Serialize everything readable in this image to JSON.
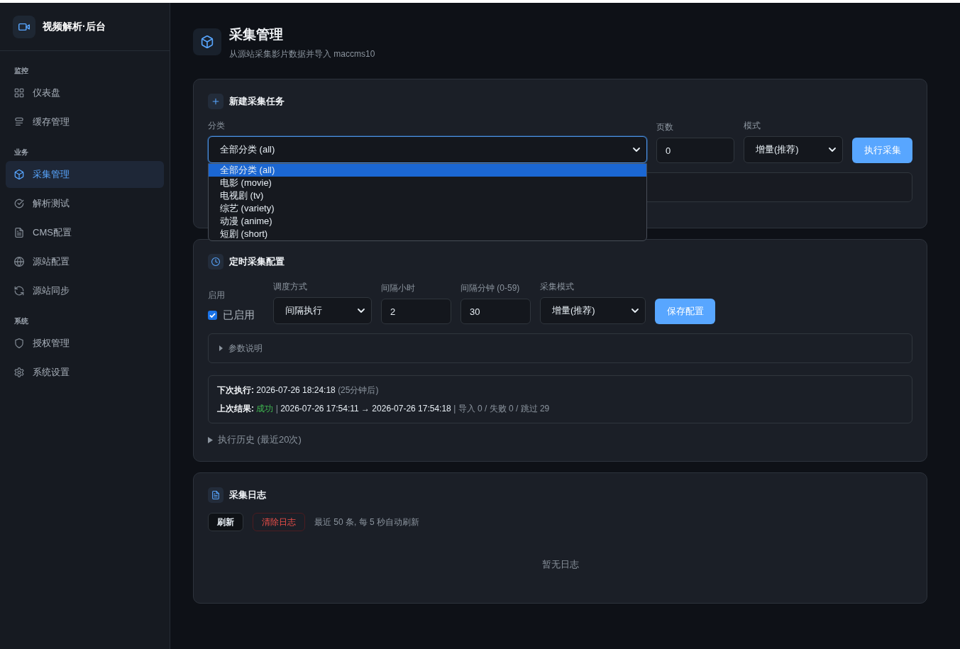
{
  "sidebar": {
    "brand": "视频解析·后台",
    "sections": [
      {
        "title": "监控",
        "items": [
          {
            "label": "仪表盘",
            "selected": false
          },
          {
            "label": "缓存管理",
            "selected": false
          }
        ]
      },
      {
        "title": "业务",
        "items": [
          {
            "label": "采集管理",
            "selected": true
          },
          {
            "label": "解析测试",
            "selected": false
          },
          {
            "label": "CMS配置",
            "selected": false
          },
          {
            "label": "源站配置",
            "selected": false
          },
          {
            "label": "源站同步",
            "selected": false
          }
        ]
      },
      {
        "title": "系统",
        "items": [
          {
            "label": "授权管理",
            "selected": false
          },
          {
            "label": "系统设置",
            "selected": false
          }
        ]
      }
    ]
  },
  "page": {
    "title": "采集管理",
    "subtitle": "从源站采集影片数据并导入 maccms10"
  },
  "new_task": {
    "title": "新建采集任务",
    "fields": [
      {
        "kind": "select",
        "label": "分类",
        "value": "全部分类 (all)",
        "expanded": true,
        "options": [
          {
            "label": "全部分类 (all)",
            "selected": true
          },
          {
            "label": "电影 (movie)",
            "selected": false
          },
          {
            "label": "电视剧 (tv)",
            "selected": false
          },
          {
            "label": "综艺 (variety)",
            "selected": false
          },
          {
            "label": "动漫 (anime)",
            "selected": false
          },
          {
            "label": "短剧 (short)",
            "selected": false
          }
        ]
      },
      {
        "kind": "input",
        "label": "页数",
        "value": "0"
      },
      {
        "kind": "select",
        "label": "模式",
        "value": "增量(推荐)",
        "expanded": false
      }
    ],
    "button": "执行采集"
  },
  "schedule": {
    "title": "定时采集配置",
    "enabled": {
      "label": "启用",
      "text": "已启用",
      "checked": true
    },
    "fields": [
      {
        "kind": "select",
        "label": "调度方式",
        "value": "间隔执行",
        "expanded": false
      },
      {
        "kind": "input",
        "label": "间隔小时",
        "value": "2"
      },
      {
        "kind": "input",
        "label": "间隔分钟 (0-59)",
        "value": "30"
      },
      {
        "kind": "select",
        "label": "采集模式",
        "value": "增量(推荐)",
        "expanded": false
      }
    ],
    "button": "保存配置",
    "params": {
      "label": "参数说明",
      "expanded": false
    },
    "status": {
      "next_run": {
        "label": "下次执行:",
        "time": "2026-07-26 18:24:18",
        "relative": "(25分钟后)"
      },
      "last_result": {
        "label": "上次结果:",
        "result": "成功",
        "success": true,
        "separator": "|",
        "period": "2026-07-26 17:54:11 → 2026-07-26 17:54:18",
        "counts": "| 导入 0 / 失败 0 / 跳过 29"
      }
    },
    "history": {
      "label": "执行历史 (最近20次)",
      "expanded": false
    }
  },
  "logs": {
    "title": "采集日志",
    "buttons": [
      {
        "kind": "default",
        "label": "刷新"
      },
      {
        "kind": "danger",
        "label": "清除日志"
      }
    ],
    "note": "最近 50 条, 每 5 秒自动刷新",
    "empty": "暂无日志"
  }
}
